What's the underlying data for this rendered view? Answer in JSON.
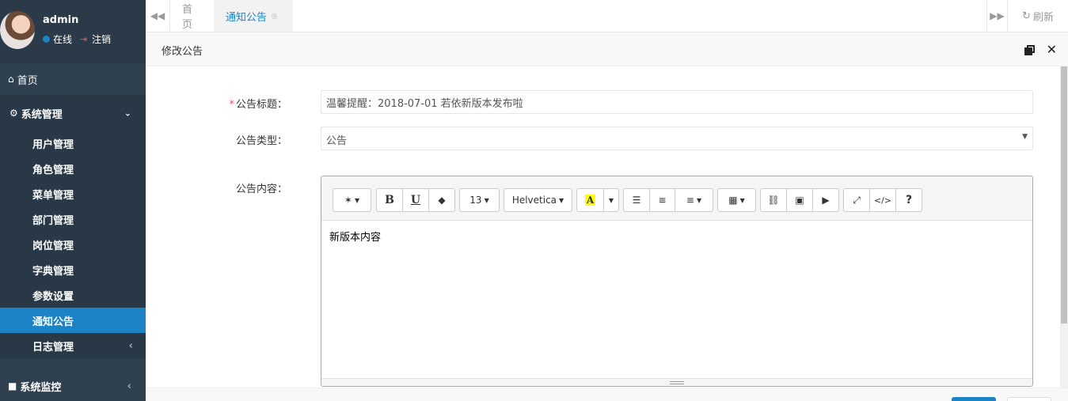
{
  "user": {
    "name": "admin",
    "status": "在线",
    "logout": "注销"
  },
  "nav": {
    "home": "首页",
    "system": "系统管理",
    "system_items": [
      "用户管理",
      "角色管理",
      "菜单管理",
      "部门管理",
      "岗位管理",
      "字典管理",
      "参数设置",
      "通知公告",
      "日志管理"
    ],
    "active_item": "通知公告",
    "monitor": "系统监控"
  },
  "tabs": {
    "home": "首页",
    "active": "通知公告",
    "refresh": "刷新"
  },
  "modal": {
    "title": "修改公告",
    "fields": {
      "title_label": "公告标题：",
      "title_value": "温馨提醒：2018-07-01 若依新版本发布啦",
      "type_label": "公告类型：",
      "type_value": "公告",
      "content_label": "公告内容："
    },
    "editor": {
      "font_size": "13",
      "font_family": "Helvetica",
      "content": "新版本内容",
      "highlight_color": "#ffff00"
    }
  },
  "colors": {
    "sidebar": "#2f4050",
    "accent": "#1c84c6",
    "required": "#ed5565"
  }
}
